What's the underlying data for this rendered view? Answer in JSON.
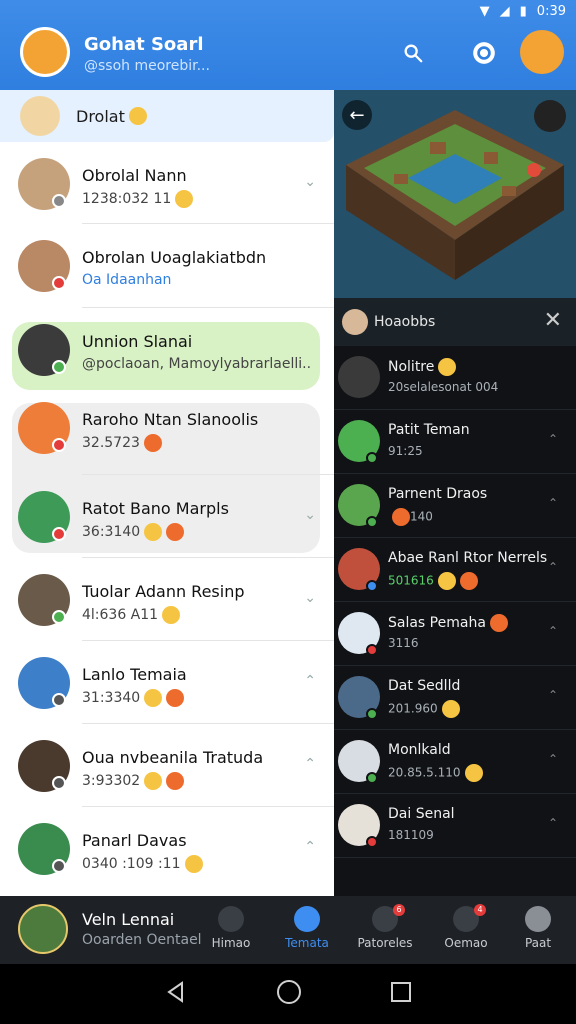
{
  "status": {
    "time": "0:39"
  },
  "header": {
    "title": "Gohat Soarl",
    "subtitle": "@ssoh meorebir..."
  },
  "pinned": {
    "label": "Drolat"
  },
  "chats": [
    {
      "name": "Obrolal Nann",
      "meta": "1238:032 11"
    },
    {
      "name": "Obrolan Uoaglakiatbdn",
      "meta": "Oa Idaanhan"
    },
    {
      "name": "Unnion Slanai",
      "meta": "@poclaoan, Mamoylyabrarlaelli.."
    },
    {
      "name": "Raroho Ntan Slanoolis",
      "meta": "32.5723"
    },
    {
      "name": "Ratot Bano Marpls",
      "meta": "36:3140"
    },
    {
      "name": "Tuolar Adann Resinp",
      "meta": "4l:636 A11"
    },
    {
      "name": "Lanlo Temaia",
      "meta": "31:3340"
    },
    {
      "name": "Oua nvbeanila Tratuda",
      "meta": "3:93302"
    },
    {
      "name": "Panarl Davas",
      "meta": "0340 :109 :11"
    }
  ],
  "game_panel": {
    "title": "Hoaobbs",
    "rows": [
      {
        "name": "Nolitre",
        "meta": "20selalesonat 004"
      },
      {
        "name": "Patit Teman",
        "meta": "91:25"
      },
      {
        "name": "Parnent Draos",
        "meta": "140"
      },
      {
        "name": "Abae Ranl Rtor Nerrels",
        "meta": "501616"
      },
      {
        "name": "Salas Pemaha",
        "meta": "3116"
      },
      {
        "name": "Dat Sedlld",
        "meta": "201.960"
      },
      {
        "name": "Monlkald",
        "meta": "20.85.5.110"
      },
      {
        "name": "Dai Senal",
        "meta": "181109"
      }
    ]
  },
  "bottom_nav": {
    "me_name": "Veln Lennai",
    "me_sub": "Ooarden Oentael",
    "items": [
      {
        "label": "Himao"
      },
      {
        "label": "Temata"
      },
      {
        "label": "Patoreles",
        "badge": "6"
      },
      {
        "label": "Oemao",
        "badge": "4"
      },
      {
        "label": "Paat"
      }
    ]
  },
  "colors": {
    "primary": "#2f7fe0",
    "active_green": "#d8f2c6",
    "dark": "#101215"
  },
  "icons": {
    "search": "search-icon",
    "chat": "chat-bubble-icon",
    "back": "back-arrow-icon",
    "close": "close-icon"
  }
}
